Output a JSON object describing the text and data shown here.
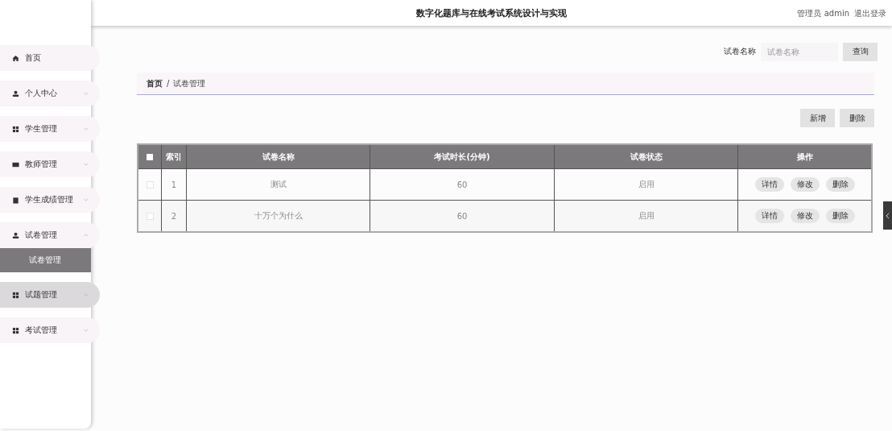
{
  "header": {
    "title": "数字化题库与在线考试系统设计与实现",
    "user": "管理员 admin",
    "logout": "退出登录"
  },
  "sidebar": {
    "items": [
      {
        "label": "首页",
        "kind": "link",
        "hovered": false
      },
      {
        "label": "个人中心",
        "kind": "submenu",
        "expanded": false,
        "hovered": false
      },
      {
        "label": "学生管理",
        "kind": "submenu",
        "expanded": false,
        "hovered": false
      },
      {
        "label": "教师管理",
        "kind": "submenu",
        "expanded": false,
        "hovered": false
      },
      {
        "label": "学生成绩管理",
        "kind": "submenu",
        "expanded": false,
        "hovered": false
      },
      {
        "label": "试卷管理",
        "kind": "submenu",
        "expanded": true,
        "hovered": false,
        "children": [
          {
            "label": "试卷管理",
            "selected": true
          }
        ]
      },
      {
        "label": "试题管理",
        "kind": "submenu",
        "expanded": false,
        "hovered": true
      },
      {
        "label": "考试管理",
        "kind": "submenu",
        "expanded": false,
        "hovered": false
      }
    ]
  },
  "search": {
    "label": "试卷名称",
    "placeholder": "试卷名称",
    "button": "查询"
  },
  "breadcrumb": [
    "首页",
    "/",
    "试卷管理"
  ],
  "actions": [
    "新增",
    "删除"
  ],
  "table": {
    "all_checked": false,
    "columns": [
      "索引",
      "试卷名称",
      "考试时长(分钟)",
      "试卷状态",
      "操作"
    ],
    "rows": [
      {
        "checked": false,
        "cells": [
          "1",
          "测试",
          "60",
          "启用"
        ],
        "buttons": [
          "详情",
          "修改",
          "删除"
        ]
      },
      {
        "checked": false,
        "cells": [
          "2",
          "十万个为什么",
          "60",
          "启用"
        ],
        "buttons": [
          "详情",
          "修改",
          "删除"
        ]
      }
    ]
  }
}
